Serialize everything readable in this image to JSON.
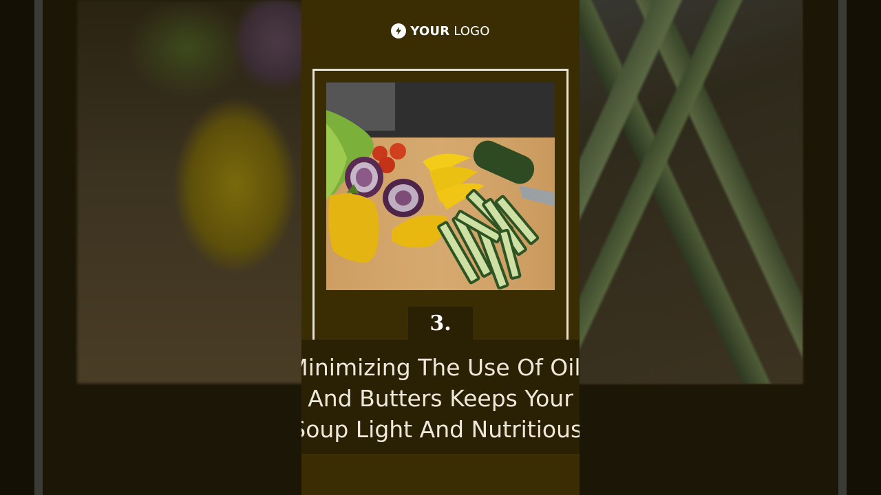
{
  "logo": {
    "icon": "lightning-bolt-icon",
    "bold": "YOUR",
    "rest": " LOGO"
  },
  "tip": {
    "number": "3.",
    "lines": [
      "Minimizing The Use Of Oils",
      "And Butters Keeps Your",
      "Soup Light And Nutritious."
    ]
  },
  "colors": {
    "panel": "#3b2d03",
    "frame": "#e8e2d2",
    "band": "#2a2003"
  }
}
